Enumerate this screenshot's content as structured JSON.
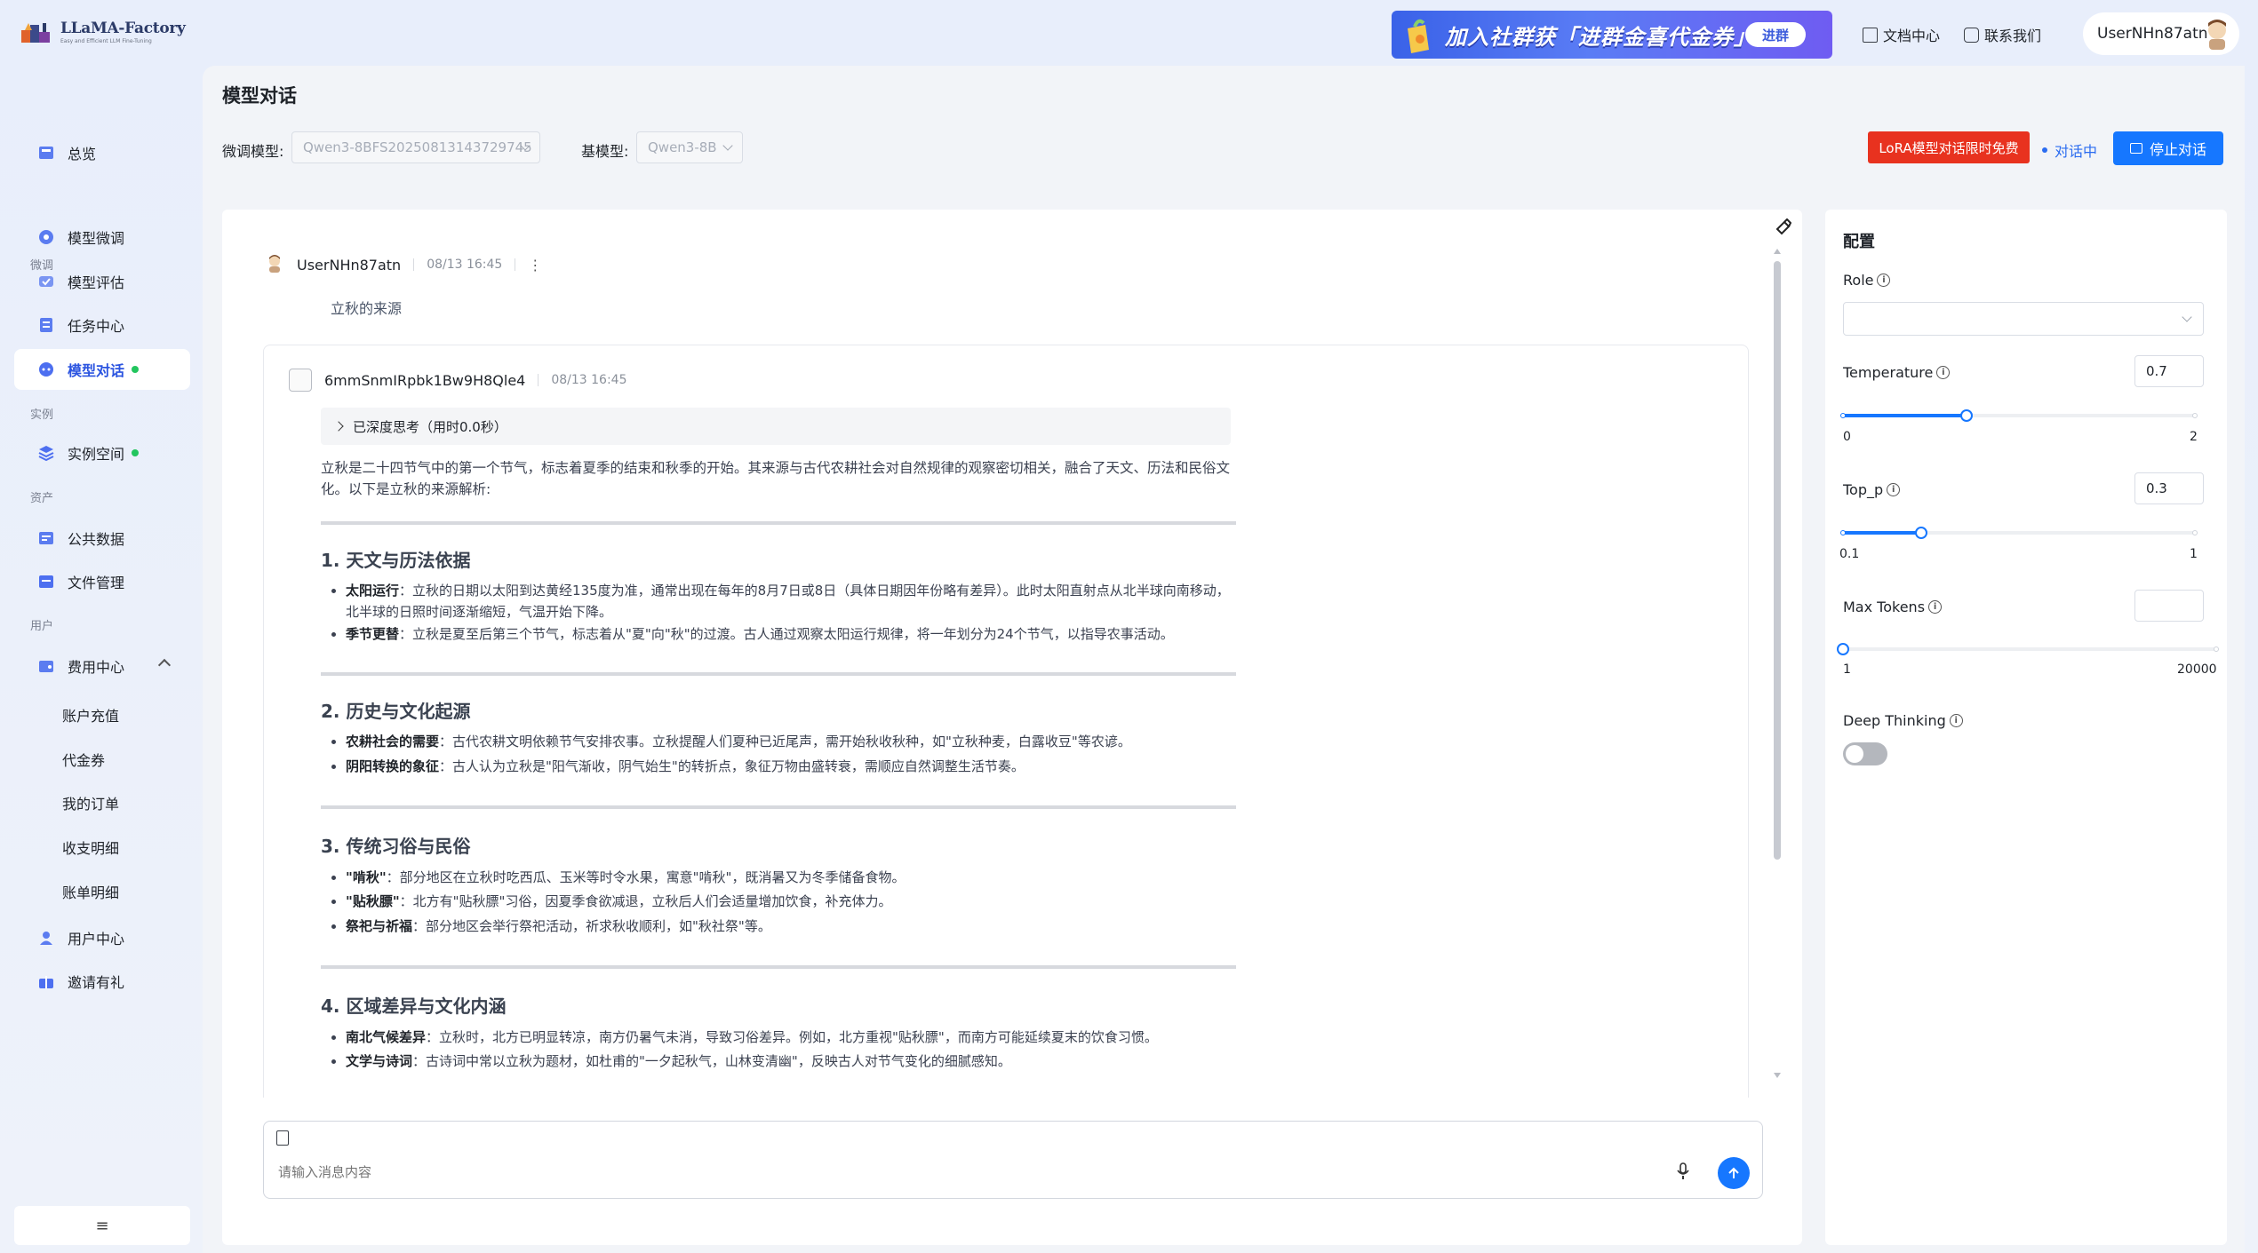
{
  "brand": {
    "name": "LLaMA-Factory",
    "tagline": "Easy and Efficient LLM Fine-Tuning"
  },
  "header": {
    "promo_text": "加入社群获「进群金喜代金券」",
    "promo_button": "进群",
    "docs_link": "文档中心",
    "contact_link": "联系我们",
    "username": "UserNHn87atn"
  },
  "sidebar": {
    "overview": "总览",
    "section_finetune": "微调",
    "model_finetune": "模型微调",
    "model_eval": "模型评估",
    "task_center": "任务中心",
    "model_chat": "模型对话",
    "section_instance": "实例",
    "instance_space": "实例空间",
    "section_assets": "资产",
    "public_data": "公共数据",
    "file_mgmt": "文件管理",
    "section_user": "用户",
    "billing_center": "费用中心",
    "billing_sub": [
      "账户充值",
      "代金券",
      "我的订单",
      "收支明细",
      "账单明细"
    ],
    "user_center": "用户中心",
    "invite": "邀请有礼",
    "collapse_glyph": "≡"
  },
  "page": {
    "title": "模型对话",
    "finetune_model_label": "微调模型:",
    "finetune_model_value": "Qwen3-8BFS20250813143729745",
    "base_model_label": "基模型:",
    "base_model_value": "Qwen3-8B",
    "lora_badge": "LoRA模型对话限时免费",
    "status": "对话中",
    "stop_button": "停止对话"
  },
  "chat": {
    "user_name": "UserNHn87atn",
    "user_time": "08/13 16:45",
    "user_question": "立秋的来源",
    "ai_name": "6mmSnmIRpbk1Bw9H8Qle4",
    "ai_time": "08/13 16:45",
    "thinking": "已深度思考（用时0.0秒）",
    "intro": "立秋是二十四节气中的第一个节气，标志着夏季的结束和秋季的开始。其来源与古代农耕社会对自然规律的观察密切相关，融合了天文、历法和民俗文化。以下是立秋的来源解析:",
    "sections": [
      {
        "title": "1. 天文与历法依据",
        "items": [
          {
            "term": "太阳运行",
            "text": "：立秋的日期以太阳到达黄经135度为准，通常出现在每年的8月7日或8日（具体日期因年份略有差异）。此时太阳直射点从北半球向南移动，北半球的日照时间逐渐缩短，气温开始下降。"
          },
          {
            "term": "季节更替",
            "text": "：立秋是夏至后第三个节气，标志着从\"夏\"向\"秋\"的过渡。古人通过观察太阳运行规律，将一年划分为24个节气，以指导农事活动。"
          }
        ]
      },
      {
        "title": "2. 历史与文化起源",
        "items": [
          {
            "term": "农耕社会的需要",
            "text": "：古代农耕文明依赖节气安排农事。立秋提醒人们夏种已近尾声，需开始秋收秋种，如\"立秋种麦，白露收豆\"等农谚。"
          },
          {
            "term": "阴阳转换的象征",
            "text": "：古人认为立秋是\"阳气渐收，阴气始生\"的转折点，象征万物由盛转衰，需顺应自然调整生活节奏。"
          }
        ]
      },
      {
        "title": "3. 传统习俗与民俗",
        "items": [
          {
            "term": "\"啃秋\"",
            "text": "：部分地区在立秋时吃西瓜、玉米等时令水果，寓意\"啃秋\"，既消暑又为冬季储备食物。"
          },
          {
            "term": "\"贴秋膘\"",
            "text": "：北方有\"贴秋膘\"习俗，因夏季食欲减退，立秋后人们会适量增加饮食，补充体力。"
          },
          {
            "term": "祭祀与祈福",
            "text": "：部分地区会举行祭祀活动，祈求秋收顺利，如\"秋社祭\"等。"
          }
        ]
      },
      {
        "title": "4. 区域差异与文化内涵",
        "items": [
          {
            "term": "南北气候差异",
            "text": "：立秋时，北方已明显转凉，南方仍暑气未消，导致习俗差异。例如，北方重视\"贴秋膘\"，而南方可能延续夏末的饮食习惯。"
          },
          {
            "term": "文学与诗词",
            "text": "：古诗词中常以立秋为题材，如杜甫的\"一夕起秋气，山林变清幽\"，反映古人对节气变化的细腻感知。"
          }
        ]
      }
    ],
    "input_placeholder": "请输入消息内容"
  },
  "config": {
    "title": "配置",
    "role_label": "Role",
    "temperature_label": "Temperature",
    "temperature_value": "0.7",
    "temperature_min": "0",
    "temperature_max": "2",
    "temperature_fraction": 0.35,
    "top_p_label": "Top_p",
    "top_p_value": "0.3",
    "top_p_min": "0.1",
    "top_p_max": "1",
    "top_p_fraction": 0.222,
    "max_tokens_label": "Max Tokens",
    "max_tokens_min": "1",
    "max_tokens_max": "20000",
    "max_tokens_fraction": 0,
    "deep_thinking_label": "Deep Thinking",
    "deep_thinking_on": false,
    "info_glyph": "i"
  },
  "colors": {
    "accent": "#1677ff",
    "danger": "#e8321f",
    "active_nav": "#2b54e0",
    "online": "#22c55e"
  }
}
